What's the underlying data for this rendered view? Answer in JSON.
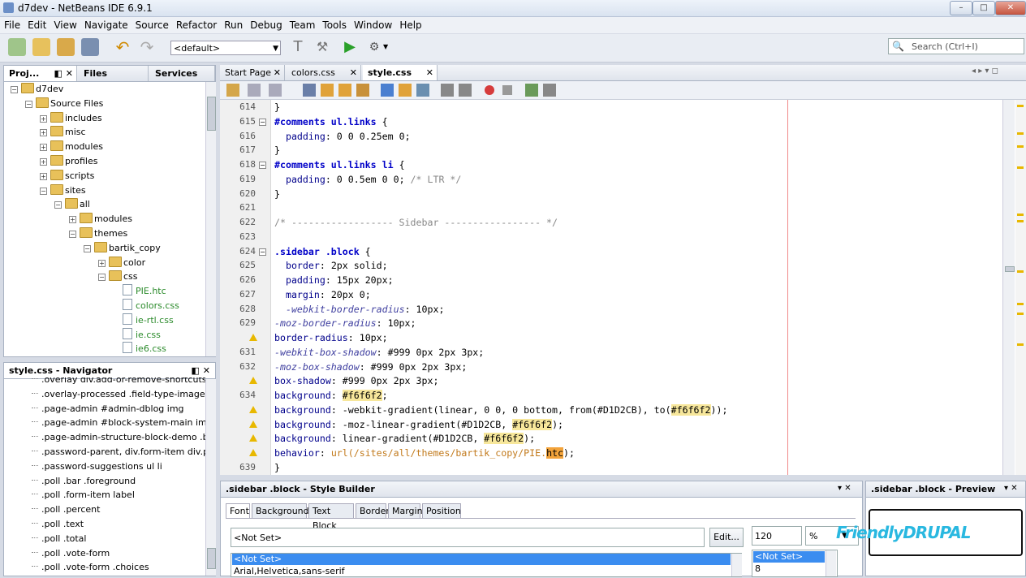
{
  "window": {
    "title": "d7dev - NetBeans IDE 6.9.1"
  },
  "menu": [
    "File",
    "Edit",
    "View",
    "Navigate",
    "Source",
    "Refactor",
    "Run",
    "Debug",
    "Team",
    "Tools",
    "Window",
    "Help"
  ],
  "toolbar": {
    "config": "<default>"
  },
  "search": {
    "placeholder": "Search (Ctrl+I)"
  },
  "left_tabs": [
    "Proj...",
    "Files",
    "Services"
  ],
  "tree": [
    {
      "label": "d7dev",
      "depth": 0
    },
    {
      "label": "Source Files",
      "depth": 1
    },
    {
      "label": "includes",
      "depth": 2
    },
    {
      "label": "misc",
      "depth": 2
    },
    {
      "label": "modules",
      "depth": 2
    },
    {
      "label": "profiles",
      "depth": 2
    },
    {
      "label": "scripts",
      "depth": 2
    },
    {
      "label": "sites",
      "depth": 2
    },
    {
      "label": "all",
      "depth": 3
    },
    {
      "label": "modules",
      "depth": 4
    },
    {
      "label": "themes",
      "depth": 4
    },
    {
      "label": "bartik_copy",
      "depth": 5
    },
    {
      "label": "color",
      "depth": 6
    },
    {
      "label": "css",
      "depth": 6
    },
    {
      "label": "PIE.htc",
      "depth": 7
    },
    {
      "label": "colors.css",
      "depth": 7
    },
    {
      "label": "ie-rtl.css",
      "depth": 7
    },
    {
      "label": "ie.css",
      "depth": 7
    },
    {
      "label": "ie6.css",
      "depth": 7
    }
  ],
  "navigator": {
    "title": "style.css - Navigator",
    "items": [
      ".overlay div.add-or-remove-shortcuts",
      ".overlay-processed .field-type-image",
      ".page-admin #admin-dblog img",
      ".page-admin #block-system-main img",
      ".page-admin-structure-block-demo .block-r",
      ".password-parent, div.form-item div.passw",
      ".password-suggestions ul li",
      ".poll .bar .foreground",
      ".poll .form-item label",
      ".poll .percent",
      ".poll .text",
      ".poll .total",
      ".poll .vote-form",
      ".poll .vote-form .choices"
    ]
  },
  "editor_tabs": [
    "Start Page",
    "colors.css",
    "style.css"
  ],
  "editor": {
    "lines": [
      {
        "n": "614",
        "segs": [
          [
            "",
            "}"
          ]
        ]
      },
      {
        "n": "615",
        "segs": [
          [
            "sel",
            "#comments ul.links"
          ],
          [
            "",
            " {"
          ]
        ]
      },
      {
        "n": "616",
        "segs": [
          [
            "",
            "  "
          ],
          [
            "prop",
            "padding"
          ],
          [
            "",
            ": 0 0 0.25em 0;"
          ]
        ]
      },
      {
        "n": "617",
        "segs": [
          [
            "",
            "}"
          ]
        ]
      },
      {
        "n": "618",
        "segs": [
          [
            "sel",
            "#comments ul.links li"
          ],
          [
            "",
            " {"
          ]
        ]
      },
      {
        "n": "619",
        "segs": [
          [
            "",
            "  "
          ],
          [
            "prop",
            "padding"
          ],
          [
            "",
            ": 0 0.5em 0 0; "
          ],
          [
            "cmt",
            "/* LTR */"
          ]
        ]
      },
      {
        "n": "620",
        "segs": [
          [
            "",
            "}"
          ]
        ]
      },
      {
        "n": "621",
        "segs": [
          [
            "",
            ""
          ]
        ]
      },
      {
        "n": "622",
        "segs": [
          [
            "cmt",
            "/* ------------------ Sidebar ----------------- */"
          ]
        ]
      },
      {
        "n": "623",
        "segs": [
          [
            "",
            ""
          ]
        ]
      },
      {
        "n": "624",
        "segs": [
          [
            "sel",
            ".sidebar .block"
          ],
          [
            "",
            " {"
          ]
        ]
      },
      {
        "n": "625",
        "segs": [
          [
            "",
            "  "
          ],
          [
            "prop",
            "border"
          ],
          [
            "",
            ": 2px solid;"
          ]
        ]
      },
      {
        "n": "626",
        "segs": [
          [
            "",
            "  "
          ],
          [
            "prop",
            "padding"
          ],
          [
            "",
            ": 15px 20px;"
          ]
        ]
      },
      {
        "n": "627",
        "segs": [
          [
            "",
            "  "
          ],
          [
            "prop",
            "margin"
          ],
          [
            "",
            ": 20px 0;"
          ]
        ]
      },
      {
        "n": "628",
        "segs": [
          [
            "",
            "  "
          ],
          [
            "vprop",
            "-webkit-border-radius"
          ],
          [
            "",
            ": 10px;"
          ]
        ]
      },
      {
        "n": "629",
        "segs": [
          [
            "vprop",
            "-moz-border-radius"
          ],
          [
            "",
            ": 10px;"
          ]
        ]
      },
      {
        "n": "",
        "segs": [
          [
            "prop",
            "border-radius"
          ],
          [
            "",
            ": 10px;"
          ]
        ]
      },
      {
        "n": "631",
        "segs": [
          [
            "vprop",
            "-webkit-box-shadow"
          ],
          [
            "",
            ": #999 0px 2px 3px;"
          ]
        ]
      },
      {
        "n": "632",
        "segs": [
          [
            "vprop",
            "-moz-box-shadow"
          ],
          [
            "",
            ": #999 0px 2px 3px;"
          ]
        ]
      },
      {
        "n": "",
        "segs": [
          [
            "prop",
            "box-shadow"
          ],
          [
            "",
            ": #999 0px 2px 3px;"
          ]
        ]
      },
      {
        "n": "634",
        "segs": [
          [
            "prop",
            "background"
          ],
          [
            "",
            ": "
          ],
          [
            "hl",
            "#f6f6f2"
          ],
          [
            "",
            ";"
          ]
        ]
      },
      {
        "n": "",
        "segs": [
          [
            "prop",
            "background"
          ],
          [
            "",
            ": -webkit-gradient(linear, 0 0, 0 bottom, from(#D1D2CB), to("
          ],
          [
            "hl",
            "#f6f6f2"
          ],
          [
            "",
            "));"
          ]
        ]
      },
      {
        "n": "",
        "segs": [
          [
            "prop",
            "background"
          ],
          [
            "",
            ": -moz-linear-gradient(#D1D2CB, "
          ],
          [
            "hl",
            "#f6f6f2"
          ],
          [
            "",
            ");"
          ]
        ]
      },
      {
        "n": "",
        "segs": [
          [
            "prop",
            "background"
          ],
          [
            "",
            ": linear-gradient(#D1D2CB, "
          ],
          [
            "hl",
            "#f6f6f2"
          ],
          [
            "",
            ");"
          ]
        ]
      },
      {
        "n": "",
        "segs": [
          [
            "prop",
            "behavior"
          ],
          [
            "",
            ": "
          ],
          [
            "url",
            "url(/sites/all/themes/bartik_copy/PIE."
          ],
          [
            "hl2",
            "htc"
          ],
          [
            "",
            ");"
          ]
        ]
      },
      {
        "n": "639",
        "segs": [
          [
            "",
            "}"
          ]
        ]
      }
    ]
  },
  "style_builder": {
    "title": ".sidebar .block - Style Builder",
    "tabs": [
      "Font",
      "Background",
      "Text Block",
      "Border",
      "Margin",
      "Position"
    ],
    "font_value": "<Not Set>",
    "edit_button": "Edit...",
    "size_value": "120",
    "unit_value": "%",
    "font_list": [
      "<Not Set>",
      "Arial,Helvetica,sans-serif"
    ],
    "size_list": [
      "<Not Set>",
      "8"
    ]
  },
  "preview": {
    "title": ".sidebar .block - Preview",
    "logo": "FriendlyDRUPAL"
  }
}
